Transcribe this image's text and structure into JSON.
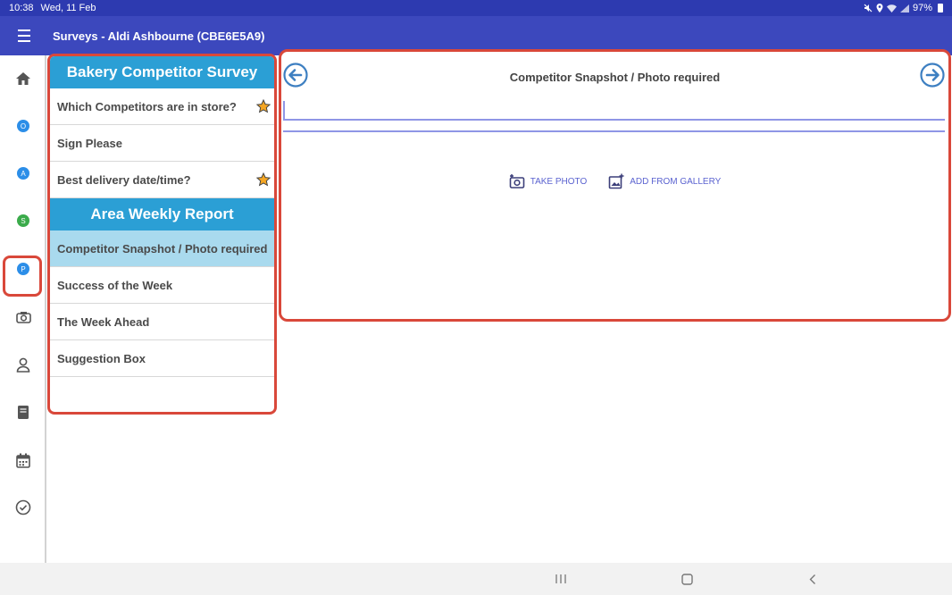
{
  "status_bar": {
    "time": "10:38",
    "date": "Wed, 11 Feb",
    "battery": "97%"
  },
  "app_bar": {
    "title": "Surveys - Aldi Ashbourne (CBE6E5A9)"
  },
  "rail": {
    "items": [
      {
        "name": "home",
        "icon": "home-icon"
      },
      {
        "name": "O",
        "letter": "O",
        "color": "#2c8ee8"
      },
      {
        "name": "A",
        "letter": "A",
        "color": "#2c8ee8"
      },
      {
        "name": "S",
        "letter": "S",
        "color": "#3bab4b"
      },
      {
        "name": "P",
        "letter": "P",
        "color": "#2c8ee8"
      },
      {
        "name": "camera",
        "icon": "camera-icon"
      },
      {
        "name": "profile",
        "icon": "person-icon"
      },
      {
        "name": "book",
        "icon": "book-icon"
      },
      {
        "name": "calendar",
        "icon": "calendar-icon"
      },
      {
        "name": "tasks",
        "icon": "check-circle-icon"
      }
    ]
  },
  "survey_list": {
    "sections": [
      {
        "title": "Bakery Competitor Survey",
        "items": [
          {
            "label": "Which Competitors are in store?",
            "starred": true
          },
          {
            "label": "Sign Please",
            "starred": false
          },
          {
            "label": "Best delivery date/time?",
            "starred": true
          }
        ]
      },
      {
        "title": "Area Weekly Report",
        "items": [
          {
            "label": "Competitor Snapshot / Photo required",
            "active": true
          },
          {
            "label": "Success of the Week"
          },
          {
            "label": "The Week Ahead"
          },
          {
            "label": "Suggestion Box"
          }
        ]
      }
    ]
  },
  "question": {
    "title": "Competitor Snapshot / Photo required",
    "answer_value": "",
    "take_photo_label": "TAKE PHOTO",
    "gallery_label": "ADD FROM GALLERY"
  },
  "colors": {
    "accent": "#3c48bd",
    "header": "#2b9fd5",
    "highlight": "#d9483a",
    "active_row": "#a9daee"
  }
}
